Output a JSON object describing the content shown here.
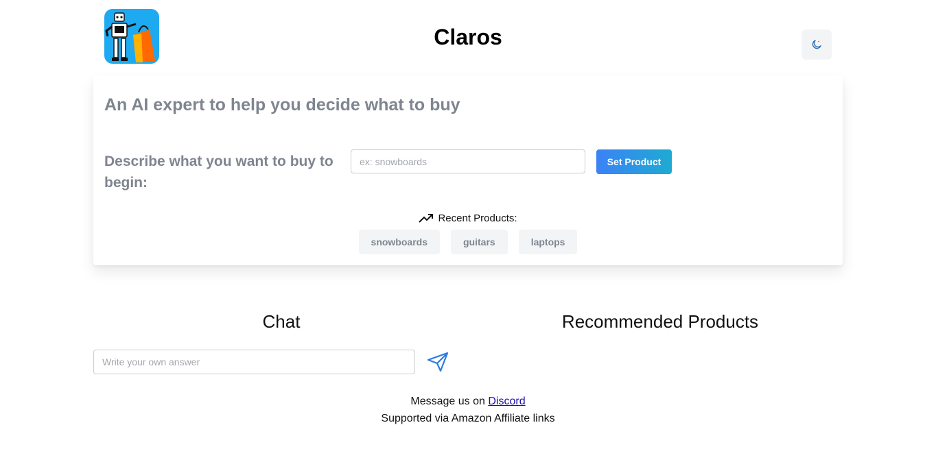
{
  "header": {
    "app_title": "Claros",
    "logo_icon": "robot-shopping-bag-logo",
    "theme_toggle_icon": "moon-icon"
  },
  "intro": {
    "heading": "An AI expert to help you decide what to buy",
    "describe_label": "Describe what you want to buy to begin:",
    "product_input": {
      "value": "",
      "placeholder": "ex: snowboards"
    },
    "set_product_label": "Set Product",
    "recent_label": "Recent Products:",
    "recent_icon": "trending-up-icon",
    "recent_products": [
      "snowboards",
      "guitars",
      "laptops"
    ]
  },
  "chat": {
    "title": "Chat",
    "answer_input": {
      "value": "",
      "placeholder": "Write your own answer"
    },
    "send_icon": "send-icon"
  },
  "recommended": {
    "title": "Recommended Products"
  },
  "footer": {
    "message_prefix": "Message us on ",
    "discord_link": "Discord",
    "supported_text": "Supported via Amazon Affiliate links"
  },
  "colors": {
    "accent": "#3b82f6",
    "logo_bg": "#1eaaf1",
    "muted_text": "#7f8590"
  }
}
